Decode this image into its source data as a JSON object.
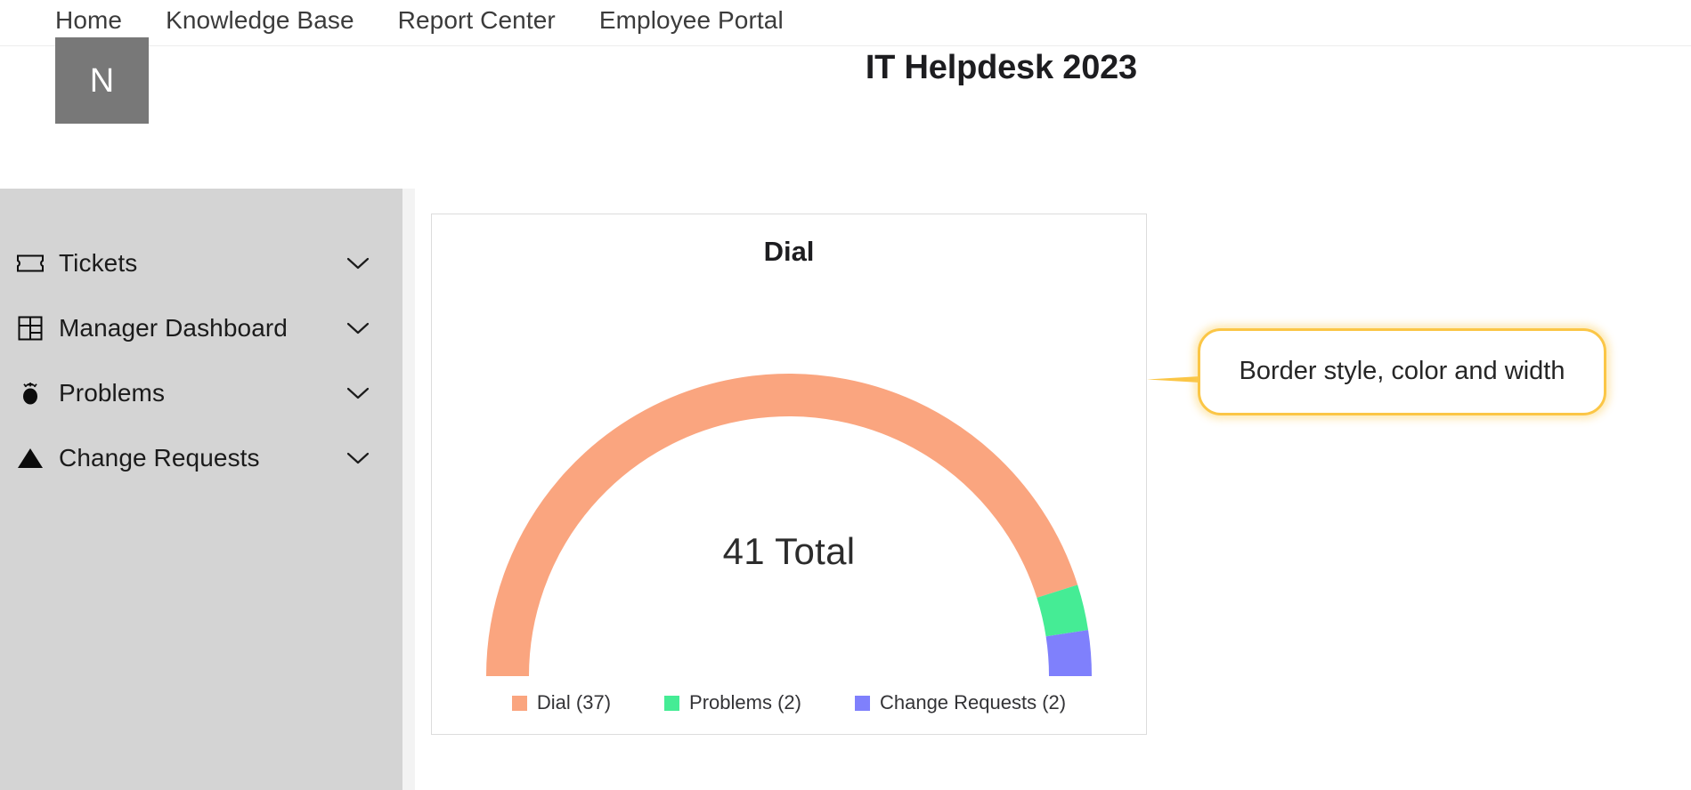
{
  "topnav": {
    "items": [
      {
        "label": "Home"
      },
      {
        "label": "Knowledge Base"
      },
      {
        "label": "Report Center"
      },
      {
        "label": "Employee Portal"
      }
    ]
  },
  "avatar": {
    "initial": "N"
  },
  "header": {
    "title": "IT Helpdesk 2023"
  },
  "sidebar": {
    "items": [
      {
        "label": "Tickets",
        "icon": "ticket-icon",
        "chevron": "chevron-down-icon"
      },
      {
        "label": "Manager Dashboard",
        "icon": "dashboard-grid-icon",
        "chevron": "chevron-down-icon"
      },
      {
        "label": "Problems",
        "icon": "bug-icon",
        "chevron": "chevron-down-icon"
      },
      {
        "label": "Change Requests",
        "icon": "triangle-icon",
        "chevron": "chevron-down-icon"
      }
    ]
  },
  "callout": {
    "text": "Border style, color and width",
    "border_color": "#FBC646",
    "fill_color": "#FFFFFF"
  },
  "colors": {
    "sidebar_bg": "#D4D4D4",
    "avatar_bg": "#787878",
    "card_border": "#DCDCDC",
    "page_bg": "#FFFFFF"
  },
  "chart_data": {
    "type": "pie",
    "title": "Dial",
    "subtitle": "",
    "variant": "half-donut-gauge",
    "center_label": "41 Total",
    "total": 41,
    "categories": [
      "Dial",
      "Problems",
      "Change Requests"
    ],
    "values": [
      37,
      2,
      2
    ],
    "colors": [
      "#FAA57F",
      "#45EC95",
      "#7F80FC"
    ],
    "legend": [
      {
        "label": "Dial (37)",
        "color": "#FAA57F",
        "value": 37
      },
      {
        "label": "Problems (2)",
        "color": "#45EC95",
        "value": 2
      },
      {
        "label": "Change Requests (2)",
        "color": "#7F80FC",
        "value": 2
      }
    ],
    "legend_position": "bottom",
    "grid": false,
    "xlabel": "",
    "ylabel": "",
    "start_angle": 180,
    "end_angle": 360
  }
}
